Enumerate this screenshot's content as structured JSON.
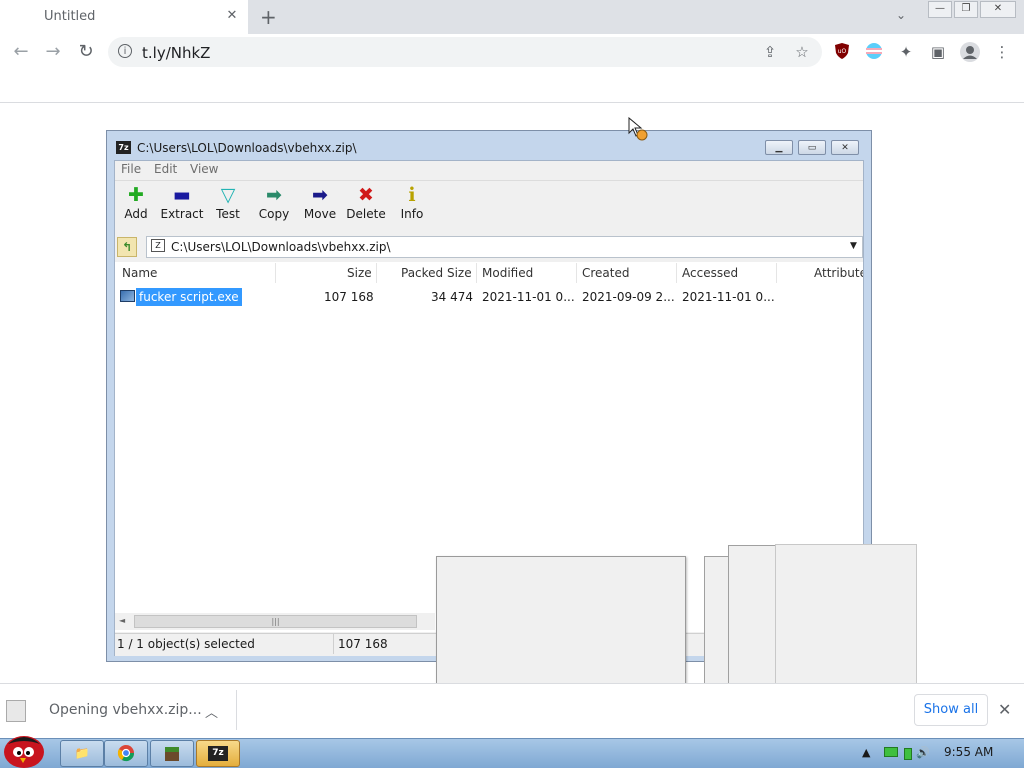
{
  "browser": {
    "tab_title": "Untitled",
    "tab_close": "✕",
    "new_tab": "+",
    "url": "t.ly/NhkZ",
    "info_glyph": "i",
    "icons": [
      "back-icon",
      "forward-icon",
      "reload-icon",
      "share-icon",
      "star-icon",
      "ublock-icon",
      "extension-flag-icon",
      "puzzle-icon",
      "sidepanel-icon",
      "profile-icon",
      "menu-icon"
    ]
  },
  "zip_window": {
    "title": "C:\\Users\\LOL\\Downloads\\vbehxx.zip\\",
    "title_icon_text": "7z",
    "menu": [
      "File",
      "Edit",
      "View"
    ],
    "tools": [
      {
        "label": "Add",
        "glyph": "✚",
        "color": "#22aa22"
      },
      {
        "label": "Extract",
        "glyph": "▬",
        "color": "#1a1aa0"
      },
      {
        "label": "Test",
        "glyph": "▽",
        "color": "#22b3b3"
      },
      {
        "label": "Copy",
        "glyph": "➡",
        "color": "#2a8a6a"
      },
      {
        "label": "Move",
        "glyph": "➡",
        "color": "#1a1a8a"
      },
      {
        "label": "Delete",
        "glyph": "✖",
        "color": "#d01a1a"
      },
      {
        "label": "Info",
        "glyph": "i",
        "color": "#b8a200"
      }
    ],
    "path": "C:\\Users\\LOL\\Downloads\\vbehxx.zip\\",
    "path_icon_text": "Z",
    "columns": [
      "Name",
      "Size",
      "Packed Size",
      "Modified",
      "Created",
      "Accessed",
      "Attributes"
    ],
    "rows": [
      {
        "name": "fucker script.exe",
        "size": "107 168",
        "packed": "34 474",
        "modified": "2021-11-01 0...",
        "created": "2021-09-09 2...",
        "accessed": "2021-11-01 0..."
      }
    ],
    "status_selected": "1 / 1 object(s) selected",
    "status_size": "107 168"
  },
  "download_shelf": {
    "item_text": "Opening vbehxx.zip...",
    "show_all": "Show all",
    "close": "✕"
  },
  "taskbar": {
    "clock": "9:55 AM",
    "zip_button_text": "7z",
    "tray_icons": [
      "tray-expand-icon",
      "network-icon",
      "battery-icon",
      "volume-icon"
    ]
  }
}
